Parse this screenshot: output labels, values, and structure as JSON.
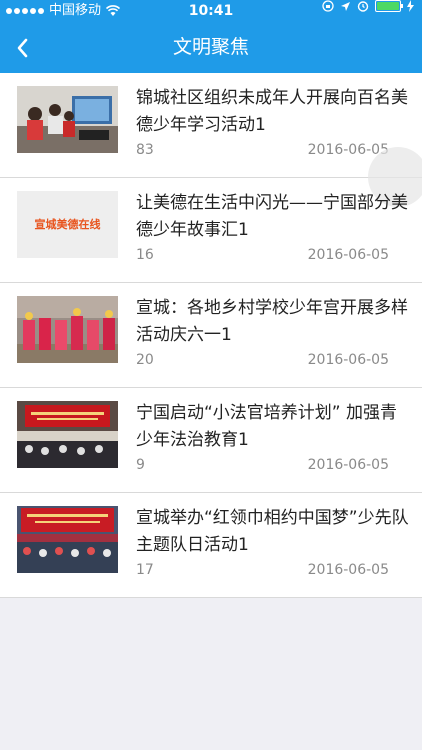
{
  "status_bar": {
    "carrier": "中国移动",
    "time": "10:41"
  },
  "nav": {
    "title": "文明聚焦",
    "back_icon": "chevron-left-icon"
  },
  "articles": [
    {
      "title": "锦城社区组织未成年人开展向百名美德少年学习活动1",
      "count": "83",
      "date": "2016-06-05"
    },
    {
      "title": "让美德在生活中闪光——宁国部分美德少年故事汇1",
      "count": "16",
      "date": "2016-06-05",
      "thumb_text": "宣城美德在线"
    },
    {
      "title": "宣城：各地乡村学校少年宫开展多样活动庆六一1",
      "count": "20",
      "date": "2016-06-05"
    },
    {
      "title": "宁国启动“小法官培养计划” 加强青少年法治教育1",
      "count": "9",
      "date": "2016-06-05"
    },
    {
      "title": "宣城举办“红领巾相约中国梦”少先队主题队日活动1",
      "count": "17",
      "date": "2016-06-05"
    }
  ],
  "colors": {
    "header": "#1f9be8",
    "background": "#efeff4"
  }
}
